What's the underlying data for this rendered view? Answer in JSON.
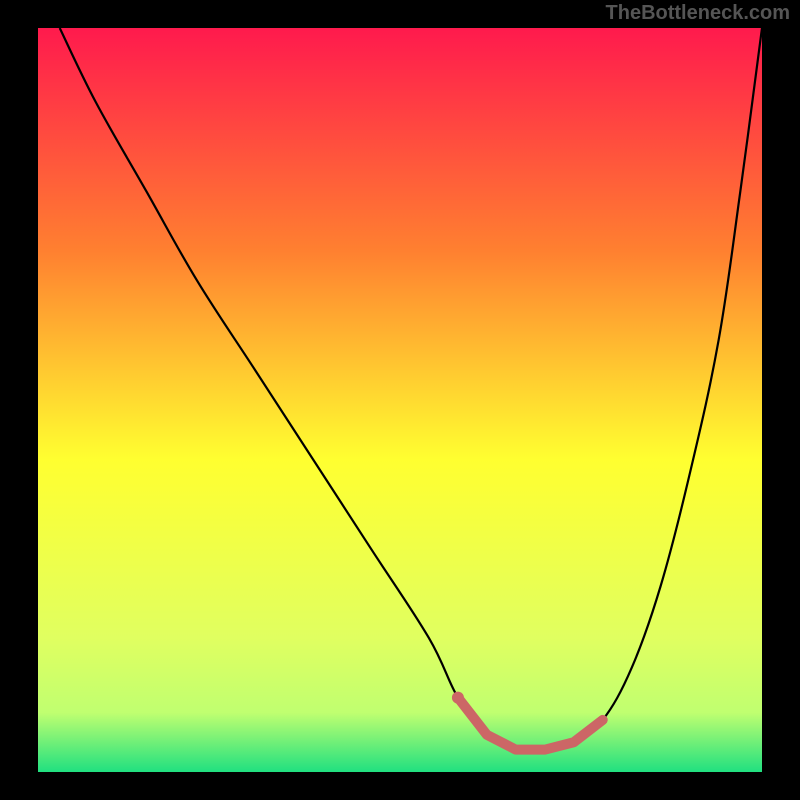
{
  "watermark": "TheBottleneck.com",
  "chart_data": {
    "type": "line",
    "title": "",
    "xlabel": "",
    "ylabel": "",
    "xlim": [
      0,
      100
    ],
    "ylim": [
      0,
      100
    ],
    "grid": false,
    "series": [
      {
        "name": "curve",
        "color": "#000000",
        "x": [
          3,
          8,
          15,
          22,
          30,
          38,
          46,
          54,
          58,
          62,
          66,
          70,
          74,
          78,
          82,
          86,
          90,
          94,
          97,
          100
        ],
        "y": [
          100,
          90,
          78,
          66,
          54,
          42,
          30,
          18,
          10,
          5,
          3,
          3,
          4,
          7,
          14,
          25,
          40,
          58,
          78,
          100
        ]
      }
    ],
    "highlight": {
      "name": "optimal-range",
      "color": "#cc6666",
      "x": [
        58,
        62,
        66,
        70,
        74,
        78
      ],
      "y": [
        10,
        5,
        3,
        3,
        4,
        7
      ]
    },
    "gradient": {
      "top": "#ff1a4d",
      "upper_mid": "#ff8030",
      "mid": "#ffff30",
      "lower_mid": "#e0ff60",
      "bottom": "#20e080"
    }
  }
}
